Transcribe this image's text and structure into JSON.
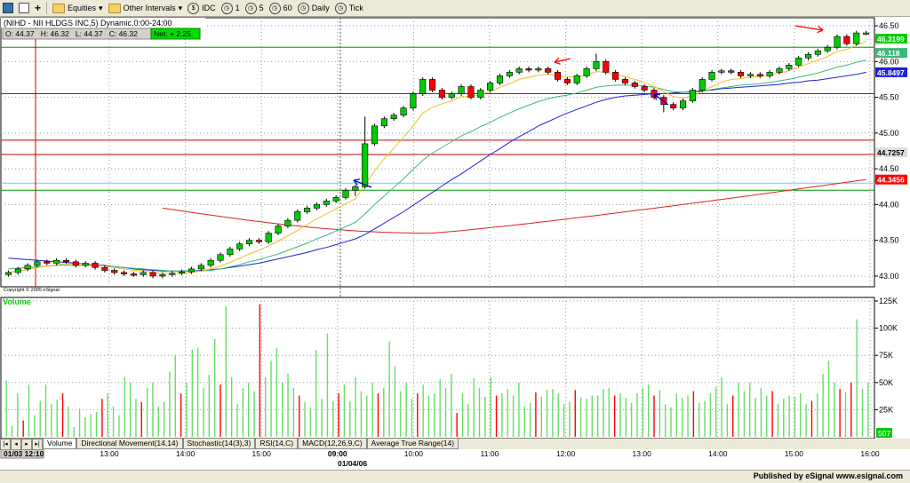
{
  "toolbar": {
    "equities": "Equities",
    "other_intervals": "Other Intervals",
    "idc": "IDC",
    "i1": "1",
    "i5": "5",
    "i60": "60",
    "daily": "Daily",
    "tick": "Tick"
  },
  "header": {
    "title": "(NIHD - NII HLDGS INC,5) Dynamic,0:00-24:00",
    "ohlc": "O: 44.37   H: 46.32   L: 44.37   C: 46.32",
    "net": "Net: + 2.25"
  },
  "copyright": "Copyright © 2005 eSignal.",
  "volume_label": "Volume",
  "tabs": [
    "Volume",
    "Directional Movement(14,14)",
    "Stochastic(14(3),3)",
    "RSI(14,C)",
    "MACD(12,26,9,C)",
    "Average True Range(14)"
  ],
  "time_axis": {
    "start_label": "01/03 12:10",
    "labels": [
      "13:00",
      "14:00",
      "15:00",
      "09:00",
      "10:00",
      "11:00",
      "12:00",
      "13:00",
      "14:00",
      "15:00",
      "16:00",
      "17:00"
    ],
    "date_label": "01/04/06"
  },
  "footer": "Published by eSignal  www.esignal.com",
  "colors": {
    "up": "#00cc00",
    "down": "#ff0000",
    "ma_fast": "#f0c020",
    "ma_mid": "#3cb878",
    "ma_slow": "#2020dd",
    "ma_long": "#e02020",
    "h_green": "#009900",
    "h_purple": "#990099",
    "h_red": "#cc0000",
    "h_cyan": "#66ccff"
  },
  "chart_data": [
    {
      "type": "candlestick",
      "title": "(NIHD - NII HLDGS INC,5) Dynamic,0:00-24:00",
      "ylim": [
        42.9,
        46.55
      ],
      "y_ticks": [
        "46.50",
        "46.00",
        "45.50",
        "45.00",
        "44.50",
        "44.00",
        "43.50",
        "43.00"
      ],
      "price_labels": [
        {
          "label": "46.3199",
          "value": 46.32,
          "color": "#00cc00"
        },
        {
          "label": "46.118",
          "value": 46.12,
          "color": "#3cb878"
        },
        {
          "label": "45.8497",
          "value": 45.85,
          "color": "#2020dd"
        },
        {
          "label": "44.7257",
          "value": 44.73,
          "color": "#dddddd"
        },
        {
          "label": "44.3456",
          "value": 44.35,
          "color": "#ff0000"
        }
      ],
      "horizontal_lines": [
        {
          "value": 46.2,
          "color": "#009900"
        },
        {
          "value": 45.55,
          "color": "#990099"
        },
        {
          "value": 44.9,
          "color": "#cc0000"
        },
        {
          "value": 44.7,
          "color": "#cc0000"
        },
        {
          "value": 44.3,
          "color": "#66ccff"
        },
        {
          "value": 44.2,
          "color": "#009900"
        }
      ],
      "closes": [
        43.05,
        43.1,
        43.15,
        43.2,
        43.18,
        43.22,
        43.2,
        43.15,
        43.18,
        43.12,
        43.08,
        43.05,
        43.03,
        43.02,
        43.05,
        43.0,
        43.02,
        43.04,
        43.06,
        43.1,
        43.15,
        43.22,
        43.3,
        43.38,
        43.45,
        43.5,
        43.48,
        43.6,
        43.7,
        43.78,
        43.9,
        43.95,
        44.0,
        44.05,
        44.1,
        44.2,
        44.25,
        44.85,
        45.1,
        45.2,
        45.25,
        45.35,
        45.55,
        45.75,
        45.6,
        45.5,
        45.55,
        45.65,
        45.5,
        45.6,
        45.7,
        45.8,
        45.85,
        45.9,
        45.88,
        45.9,
        45.85,
        45.75,
        45.7,
        45.8,
        45.9,
        46.0,
        45.85,
        45.75,
        45.7,
        45.65,
        45.6,
        45.5,
        45.4,
        45.35,
        45.45,
        45.6,
        45.75,
        45.85,
        45.87,
        45.85,
        45.8,
        45.82,
        45.8,
        45.85,
        45.9,
        45.95,
        46.05,
        46.1,
        46.15,
        46.2,
        46.35,
        46.25,
        46.4,
        46.4
      ],
      "ma_fast": [
        43.05,
        43.07,
        43.09,
        43.12,
        43.14,
        43.16,
        43.17,
        43.17,
        43.17,
        43.16,
        43.14,
        43.12,
        43.1,
        43.08,
        43.07,
        43.05,
        43.04,
        43.04,
        43.04,
        43.05,
        43.07,
        43.1,
        43.14,
        43.19,
        43.25,
        43.31,
        43.36,
        43.42,
        43.49,
        43.56,
        43.64,
        43.72,
        43.8,
        43.87,
        43.94,
        44.01,
        44.08,
        44.27,
        44.47,
        44.64,
        44.79,
        44.94,
        45.1,
        45.28,
        45.36,
        45.41,
        45.45,
        45.51,
        45.51,
        45.54,
        45.58,
        45.64,
        45.69,
        45.75,
        45.78,
        45.81,
        45.82,
        45.8,
        45.78,
        45.79,
        45.81,
        45.86,
        45.85,
        45.82,
        45.79,
        45.75,
        45.71,
        45.65,
        45.58,
        45.51,
        45.49,
        45.52,
        45.58,
        45.65,
        45.71,
        45.75,
        45.76,
        45.78,
        45.79,
        45.81,
        45.84,
        45.87,
        45.92,
        45.97,
        46.02,
        46.07,
        46.14,
        46.17,
        46.23,
        46.28
      ],
      "ma_mid": [
        43.1,
        43.11,
        43.12,
        43.13,
        43.14,
        43.15,
        43.15,
        43.15,
        43.15,
        43.15,
        43.14,
        43.13,
        43.12,
        43.11,
        43.1,
        43.09,
        43.08,
        43.07,
        43.07,
        43.07,
        43.07,
        43.08,
        43.1,
        43.13,
        43.16,
        43.2,
        43.23,
        43.27,
        43.31,
        43.36,
        43.41,
        43.46,
        43.52,
        43.57,
        43.63,
        43.69,
        43.75,
        43.87,
        44.0,
        44.12,
        44.24,
        44.36,
        44.49,
        44.62,
        44.72,
        44.8,
        44.88,
        44.96,
        45.02,
        45.09,
        45.15,
        45.22,
        45.28,
        45.34,
        45.39,
        45.44,
        45.48,
        45.51,
        45.53,
        45.56,
        45.6,
        45.64,
        45.66,
        45.67,
        45.67,
        45.67,
        45.66,
        45.64,
        45.61,
        45.58,
        45.57,
        45.57,
        45.58,
        45.61,
        45.63,
        45.65,
        45.67,
        45.68,
        45.69,
        45.71,
        45.73,
        45.75,
        45.78,
        45.81,
        45.84,
        45.88,
        45.92,
        45.95,
        45.99,
        46.02
      ],
      "ma_slow": [
        43.25,
        43.24,
        43.23,
        43.22,
        43.21,
        43.2,
        43.19,
        43.18,
        43.17,
        43.16,
        43.15,
        43.13,
        43.12,
        43.1,
        43.09,
        43.08,
        43.07,
        43.07,
        43.07,
        43.07,
        43.08,
        43.09,
        43.1,
        43.12,
        43.14,
        43.16,
        43.18,
        43.21,
        43.24,
        43.27,
        43.3,
        43.33,
        43.37,
        43.4,
        43.44,
        43.48,
        43.52,
        43.58,
        43.66,
        43.74,
        43.82,
        43.9,
        43.99,
        44.08,
        44.17,
        44.26,
        44.35,
        44.43,
        44.52,
        44.61,
        44.7,
        44.78,
        44.87,
        44.95,
        45.02,
        45.1,
        45.16,
        45.22,
        45.28,
        45.33,
        45.38,
        45.43,
        45.47,
        45.5,
        45.52,
        45.53,
        45.54,
        45.55,
        45.55,
        45.56,
        45.57,
        45.58,
        45.59,
        45.6,
        45.62,
        45.63,
        45.64,
        45.65,
        45.66,
        45.67,
        45.68,
        45.7,
        45.71,
        45.73,
        45.74,
        45.76,
        45.78,
        45.8,
        45.82,
        45.85
      ],
      "ma_long_start": 43.95,
      "ma_long_min": 43.6,
      "ma_long_end": 44.35
    },
    {
      "type": "bar",
      "title": "Volume",
      "ylim": [
        0,
        125000
      ],
      "y_ticks": [
        "125K",
        "100K",
        "75K",
        "50K",
        "25K"
      ],
      "last_label": "507",
      "values": [
        52000,
        10000,
        40000,
        15000,
        48000,
        20000,
        33000,
        48000,
        30000,
        34000,
        40000,
        28000,
        9000,
        26000,
        18000,
        21000,
        23000,
        35000,
        40000,
        28000,
        20000,
        55000,
        50000,
        35000,
        32000,
        45000,
        50000,
        28000,
        32000,
        60000,
        75000,
        40000,
        50000,
        80000,
        82000,
        45000,
        57000,
        90000,
        48000,
        120000,
        55000,
        30000,
        45000,
        50000,
        42000,
        122000,
        55000,
        70000,
        82000,
        50000,
        58000,
        45000,
        38000,
        32000,
        27000,
        80000,
        35000,
        95000,
        33000,
        40000,
        48000,
        33000,
        55000,
        42000,
        38000,
        50000,
        40000,
        45000,
        88000,
        65000,
        42000,
        50000,
        35000,
        40000,
        48000,
        38000,
        40000,
        53000,
        45000,
        58000,
        22000,
        40000,
        30000,
        54000,
        45000,
        37000,
        55000,
        38000,
        40000,
        44000,
        38000,
        50000,
        28000,
        31000,
        41000,
        37000,
        43000,
        44000,
        40000,
        30000,
        32000,
        43000,
        36000,
        35000,
        38000,
        38000,
        44000,
        45000,
        38000,
        40000,
        36000,
        31000,
        40000,
        45000,
        48000,
        38000,
        43000,
        30000,
        27000,
        40000,
        36000,
        38000,
        42000,
        31000,
        33000,
        40000,
        46000,
        55000,
        30000,
        38000,
        50000,
        42000,
        50000,
        36000,
        45000,
        38000,
        42000,
        30000,
        35000,
        38000,
        37000,
        40000,
        30000,
        33000,
        40000,
        58000,
        70000,
        50000,
        44000,
        41000,
        50000,
        108000,
        44000,
        50000
      ]
    }
  ]
}
